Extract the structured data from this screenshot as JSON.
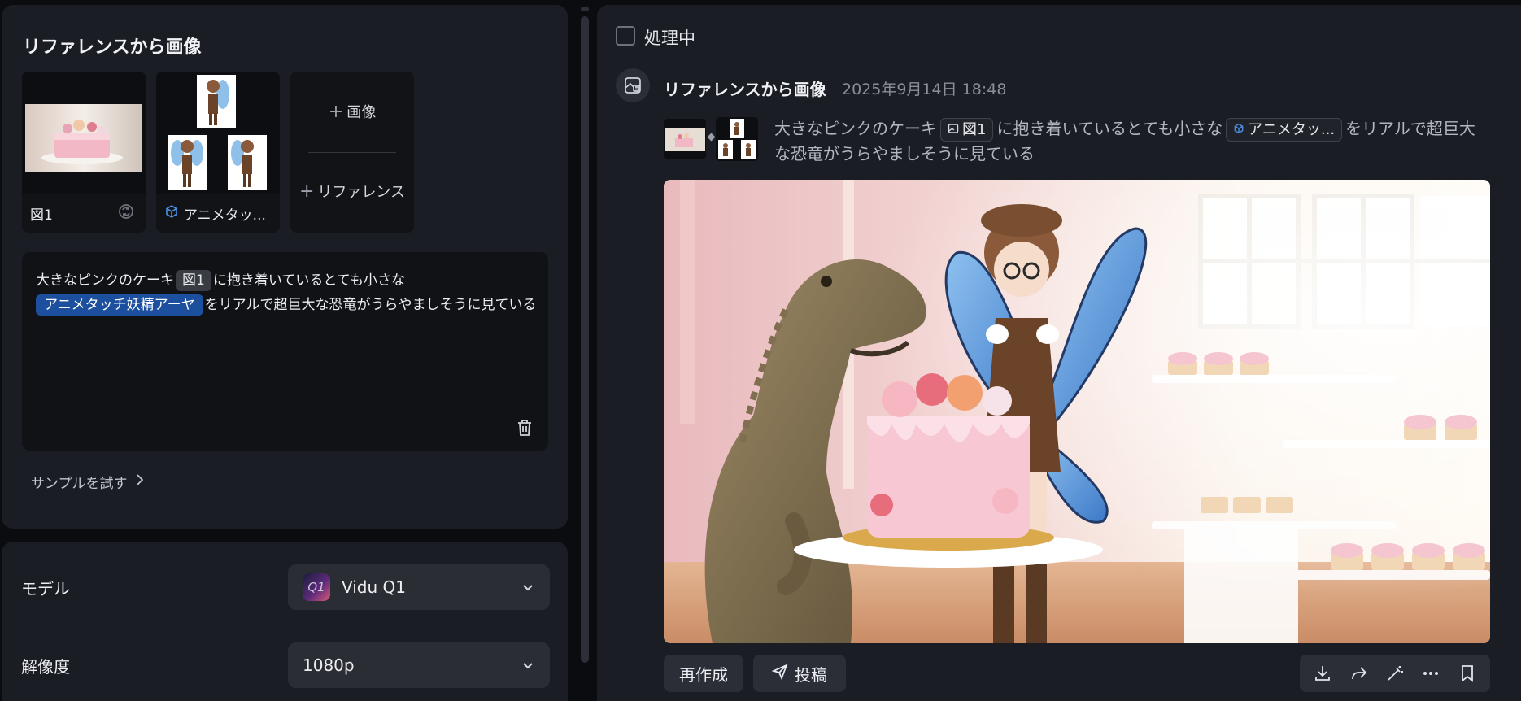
{
  "left_panel": {
    "title": "リファレンスから画像",
    "references": [
      {
        "label": "図1",
        "kind": "image"
      },
      {
        "label": "アニメタッ...",
        "kind": "character"
      }
    ],
    "add_image_label": "画像",
    "add_reference_label": "リファレンス",
    "prompt": {
      "part1": "大きなピンクのケーキ",
      "chip1": "図1",
      "part2": "に抱き着いているとても小さな",
      "chip2": "アニメタッチ妖精アーヤ",
      "part3": "をリアルで超巨大な恐竜がうらやましそうに見ている"
    },
    "try_sample_label": "サンプルを試す"
  },
  "settings": {
    "model_label": "モデル",
    "model_value": "Vidu Q1",
    "model_logo_text": "Q1",
    "resolution_label": "解像度",
    "resolution_value": "1080p"
  },
  "right_panel": {
    "processing_label": "処理中",
    "generation": {
      "title": "リファレンスから画像",
      "timestamp": "2025年9月14日 18:48",
      "prompt_part1": "大きなピンクのケーキ",
      "chip1": "図1",
      "prompt_part2": "に抱き着いているとても小さな",
      "chip2": "アニメタッ...",
      "prompt_part3": "をリアルで超巨大",
      "prompt_line2": "な恐竜がうらやましそうに見ている"
    },
    "actions": {
      "recreate_label": "再作成",
      "post_label": "投稿"
    },
    "toolbar_icons": [
      "download-icon",
      "share-icon",
      "magic-wand-icon",
      "more-icon",
      "bookmark-icon"
    ]
  },
  "colors": {
    "panel_bg": "#1b1d24",
    "page_bg": "#0b0c10",
    "chip_blue": "#1c4f9e",
    "button_bg": "#2b2e37"
  }
}
